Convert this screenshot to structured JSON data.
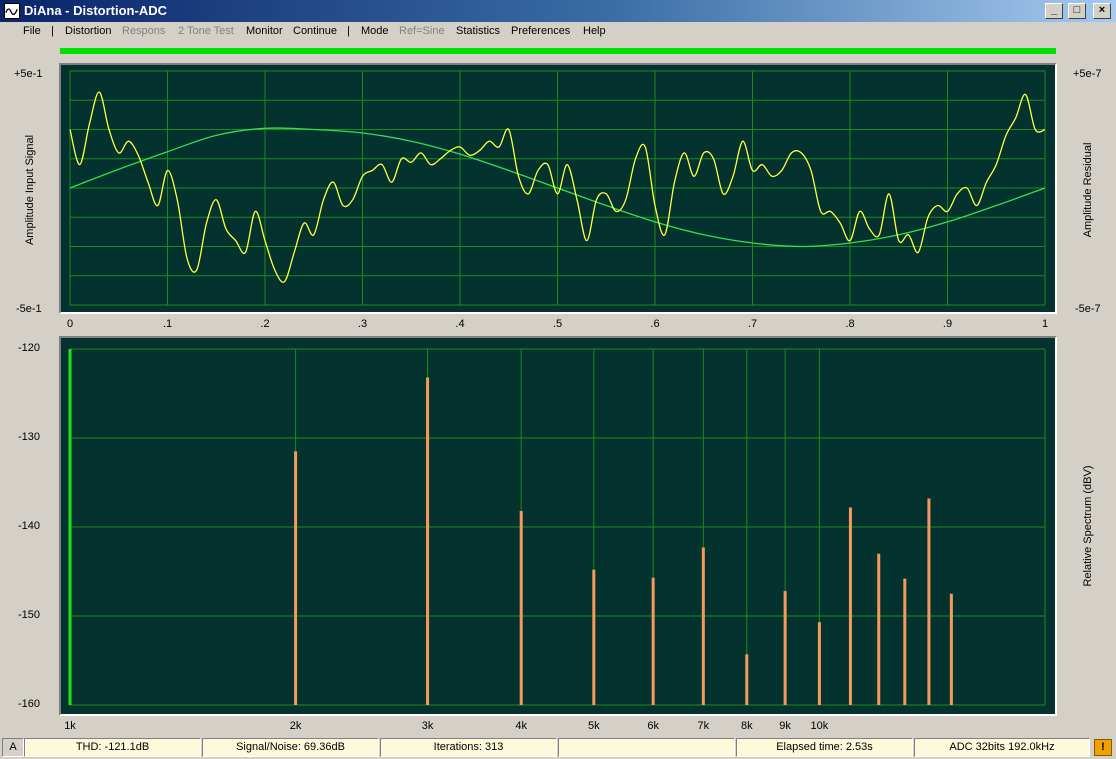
{
  "window": {
    "title": "DiAna - Distortion-ADC",
    "minimize": "_",
    "maximize": "□",
    "close": "×"
  },
  "menu": {
    "items": [
      {
        "label": "File",
        "enabled": true
      },
      {
        "label": "Distortion",
        "enabled": true
      },
      {
        "label": "Respons",
        "enabled": false
      },
      {
        "label": "2 Tone Test",
        "enabled": false
      },
      {
        "label": "Monitor",
        "enabled": true
      },
      {
        "label": "Continue",
        "enabled": true
      },
      {
        "label": "Mode",
        "enabled": true
      },
      {
        "label": "Ref=Sine",
        "enabled": false
      },
      {
        "label": "Statistics",
        "enabled": true
      },
      {
        "label": "Preferences",
        "enabled": true
      },
      {
        "label": "Help",
        "enabled": true
      }
    ],
    "separator": "|"
  },
  "colors": {
    "plot_bg": "#04322e",
    "grid": "#1e8a1e",
    "signal": "#ffff40",
    "sine": "#30e050",
    "bars": "#f59a5a",
    "fundamental": "#20e020"
  },
  "chart_data": [
    {
      "type": "line",
      "left_axis_title": "Amplitude Input Signal",
      "right_axis_title": "Amplitude Residual",
      "left_ylim_labels": [
        "+5e-1",
        "-5e-1"
      ],
      "right_ylim_labels": [
        "+5e-7",
        "-5e-7"
      ],
      "ylim": [
        -1,
        1
      ],
      "xlim": [
        0,
        1
      ],
      "x_ticks": [
        "0",
        ".1",
        ".2",
        ".3",
        ".4",
        ".5",
        ".6",
        ".7",
        ".8",
        ".9",
        "1"
      ],
      "series": [
        {
          "kind": "sine",
          "x": [
            0,
            0.05,
            0.1,
            0.15,
            0.2,
            0.25,
            0.3,
            0.35,
            0.4,
            0.45,
            0.5,
            0.55,
            0.6,
            0.65,
            0.7,
            0.75,
            0.8,
            0.85,
            0.9,
            0.95,
            1.0
          ],
          "y": [
            0,
            0.16,
            0.31,
            0.45,
            0.51,
            0.5,
            0.47,
            0.4,
            0.29,
            0.15,
            0,
            -0.15,
            -0.29,
            -0.4,
            -0.47,
            -0.5,
            -0.47,
            -0.4,
            -0.29,
            -0.15,
            0
          ]
        },
        {
          "kind": "residual",
          "x": [
            0,
            0.01,
            0.02,
            0.03,
            0.04,
            0.05,
            0.06,
            0.07,
            0.08,
            0.09,
            0.1,
            0.11,
            0.12,
            0.13,
            0.14,
            0.15,
            0.16,
            0.17,
            0.18,
            0.19,
            0.2,
            0.21,
            0.22,
            0.23,
            0.24,
            0.25,
            0.26,
            0.27,
            0.28,
            0.29,
            0.3,
            0.31,
            0.32,
            0.33,
            0.34,
            0.35,
            0.36,
            0.37,
            0.38,
            0.39,
            0.4,
            0.41,
            0.42,
            0.43,
            0.44,
            0.45,
            0.46,
            0.47,
            0.48,
            0.49,
            0.5,
            0.51,
            0.52,
            0.53,
            0.54,
            0.55,
            0.56,
            0.57,
            0.58,
            0.59,
            0.6,
            0.61,
            0.62,
            0.63,
            0.64,
            0.65,
            0.66,
            0.67,
            0.68,
            0.69,
            0.7,
            0.71,
            0.72,
            0.73,
            0.74,
            0.75,
            0.76,
            0.77,
            0.78,
            0.79,
            0.8,
            0.81,
            0.82,
            0.83,
            0.84,
            0.85,
            0.86,
            0.87,
            0.88,
            0.89,
            0.9,
            0.91,
            0.92,
            0.93,
            0.94,
            0.95,
            0.96,
            0.97,
            0.98,
            0.99,
            1.0
          ],
          "y": [
            0.5,
            0.2,
            0.55,
            0.82,
            0.5,
            0.3,
            0.4,
            0.28,
            0.05,
            -0.15,
            0.15,
            -0.1,
            -0.6,
            -0.7,
            -0.3,
            -0.1,
            -0.35,
            -0.45,
            -0.55,
            -0.2,
            -0.45,
            -0.7,
            -0.8,
            -0.55,
            -0.3,
            -0.4,
            -0.1,
            0.05,
            -0.15,
            -0.1,
            0.1,
            0.15,
            0.2,
            0.05,
            0.25,
            0.22,
            0.3,
            0.2,
            0.25,
            0.32,
            0.35,
            0.28,
            0.32,
            0.4,
            0.35,
            0.5,
            0.1,
            -0.05,
            0.15,
            0.2,
            -0.05,
            0.2,
            -0.1,
            -0.45,
            -0.1,
            -0.05,
            -0.2,
            -0.1,
            0.25,
            0.35,
            -0.15,
            -0.4,
            0.05,
            0.3,
            0.1,
            0.3,
            0.25,
            -0.05,
            0.1,
            0.4,
            0.15,
            0.2,
            0.1,
            0.15,
            0.3,
            0.3,
            0.15,
            -0.2,
            -0.2,
            -0.3,
            -0.45,
            -0.2,
            -0.35,
            -0.4,
            -0.05,
            -0.45,
            -0.4,
            -0.55,
            -0.25,
            -0.15,
            -0.2,
            -0.05,
            0.0,
            -0.15,
            0.05,
            0.2,
            0.45,
            0.6,
            0.8,
            0.5,
            0.5
          ]
        }
      ]
    },
    {
      "type": "bar",
      "ylabel": "Relative Spectrum (dBV)",
      "ylim": [
        -160,
        -120
      ],
      "y_ticks": [
        "-120",
        "-130",
        "-140",
        "-150",
        "-160"
      ],
      "x_scale": "log",
      "xlim": [
        1000,
        20000
      ],
      "x_ticks": [
        {
          "label": "1k",
          "value": 1000
        },
        {
          "label": "2k",
          "value": 2000
        },
        {
          "label": "3k",
          "value": 3000
        },
        {
          "label": "4k",
          "value": 4000
        },
        {
          "label": "5k",
          "value": 5000
        },
        {
          "label": "6k",
          "value": 6000
        },
        {
          "label": "7k",
          "value": 7000
        },
        {
          "label": "8k",
          "value": 8000
        },
        {
          "label": "9k",
          "value": 9000
        },
        {
          "label": "10k",
          "value": 10000
        }
      ],
      "fundamental": {
        "x": 1000
      },
      "harmonics": [
        {
          "x": 2000,
          "y": -131.5
        },
        {
          "x": 3000,
          "y": -123.2
        },
        {
          "x": 4000,
          "y": -138.2
        },
        {
          "x": 5000,
          "y": -144.8
        },
        {
          "x": 6000,
          "y": -145.7
        },
        {
          "x": 7000,
          "y": -142.3
        },
        {
          "x": 8000,
          "y": -154.3
        },
        {
          "x": 9000,
          "y": -147.2
        },
        {
          "x": 10000,
          "y": -150.7
        },
        {
          "x": 11000,
          "y": -137.8
        },
        {
          "x": 12000,
          "y": -143.0
        },
        {
          "x": 13000,
          "y": -145.8
        },
        {
          "x": 14000,
          "y": -136.8
        },
        {
          "x": 15000,
          "y": -147.5
        }
      ]
    }
  ],
  "status": {
    "channel": "A",
    "thd": "THD: -121.1dB",
    "snr": "Signal/Noise:  69.36dB",
    "iterations": "Iterations: 313",
    "empty": "",
    "elapsed": "Elapsed time: 2.53s",
    "adc": "ADC 32bits 192.0kHz",
    "warn": "!"
  }
}
